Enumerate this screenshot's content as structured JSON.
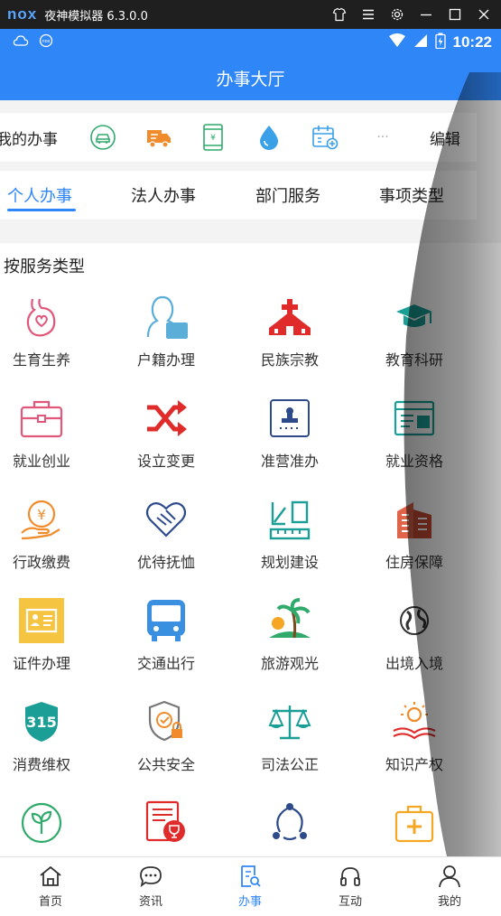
{
  "emulator": {
    "logo": "nox",
    "title": "夜神模拟器 6.3.0.0"
  },
  "status": {
    "time": "10:22"
  },
  "appbar": {
    "title": "办事大厅"
  },
  "quick": {
    "label": "我的办事",
    "edit": "编辑",
    "more": "···"
  },
  "tabs": [
    "个人办事",
    "法人办事",
    "部门服务",
    "事项类型"
  ],
  "section": {
    "title": "按服务类型"
  },
  "services": [
    "生育生养",
    "户籍办理",
    "民族宗教",
    "教育科研",
    "就业创业",
    "设立变更",
    "准营准办",
    "就业资格",
    "行政缴费",
    "优待抚恤",
    "规划建设",
    "住房保障",
    "证件办理",
    "交通出行",
    "旅游观光",
    "出境入境",
    "消费维权",
    "公共安全",
    "司法公正",
    "知识产权"
  ],
  "bottom_nav": [
    "首页",
    "资讯",
    "办事",
    "互动",
    "我的"
  ],
  "colors": {
    "primary": "#2f86f6",
    "green": "#2faa6b",
    "red": "#e02b2b",
    "orange": "#f08c2c",
    "teal": "#1a9e96",
    "pink": "#e0577a"
  }
}
